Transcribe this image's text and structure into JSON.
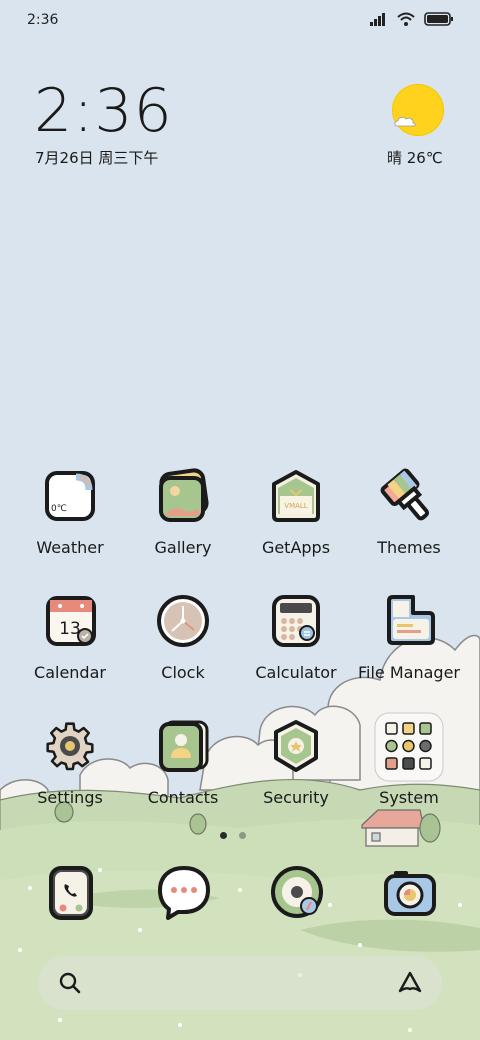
{
  "status_bar": {
    "time": "2:36",
    "icons": [
      "signal-icon",
      "wifi-icon",
      "battery-icon"
    ]
  },
  "clock_widget": {
    "time": "2:36",
    "date": "7月26日 周三下午"
  },
  "weather_widget": {
    "condition_icon": "sun-cloud-icon",
    "text": "晴 26℃"
  },
  "apps": [
    {
      "label": "Weather",
      "icon": "weather-icon"
    },
    {
      "label": "Gallery",
      "icon": "gallery-icon"
    },
    {
      "label": "GetApps",
      "icon": "getapps-icon"
    },
    {
      "label": "Themes",
      "icon": "themes-brush-icon"
    },
    {
      "label": "Calendar",
      "icon": "calendar-icon"
    },
    {
      "label": "Clock",
      "icon": "clock-icon"
    },
    {
      "label": "Calculator",
      "icon": "calculator-icon"
    },
    {
      "label": "File Manager",
      "icon": "file-manager-icon"
    },
    {
      "label": "Settings",
      "icon": "settings-gear-icon"
    },
    {
      "label": "Contacts",
      "icon": "contacts-icon"
    },
    {
      "label": "Security",
      "icon": "security-shield-icon"
    },
    {
      "label": "System",
      "icon": "system-folder-icon"
    }
  ],
  "icon_text": {
    "weather_temp": "0℃",
    "calendar_day": "13",
    "getapps_brand": "VMALL"
  },
  "dock": [
    {
      "icon": "phone-icon"
    },
    {
      "icon": "messages-icon"
    },
    {
      "icon": "music-icon"
    },
    {
      "icon": "camera-icon"
    }
  ],
  "page_indicator": {
    "count": 2,
    "active": 0
  },
  "search_bar": {
    "left_icon": "search-icon",
    "right_icon": "assistant-icon"
  },
  "colors": {
    "sky": "#d9e4ee",
    "grass": "#c9dbb6",
    "sun": "#ffd21d",
    "icon_outline": "#1b1b1b"
  }
}
